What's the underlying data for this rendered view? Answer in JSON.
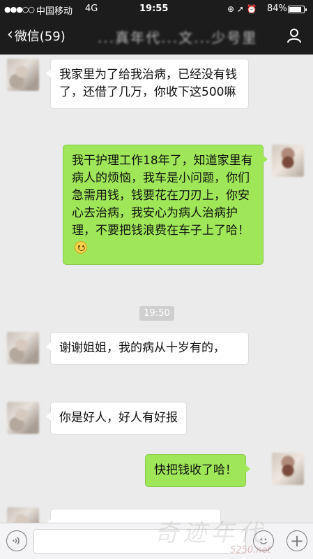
{
  "status_bar": {
    "signal": "●●●○○",
    "carrier": "中国移动",
    "network": "4G",
    "time": "19:55",
    "icons": "⊕ ➚ ⏰",
    "battery_pct": "84%",
    "battery_level": 0.84
  },
  "nav": {
    "back_label": "微信(59)",
    "chat_title": "...真年代...文...少号里",
    "profile_icon": "person-icon"
  },
  "messages": [
    {
      "side": "in",
      "text": "我家里为了给我治病，已经没有钱了，还借了几万，你收下这500嘛"
    },
    {
      "side": "out",
      "text": "我干护理工作18年了，知道家里有病人的烦恼，我车是小问题，你们急需用钱，钱要花在刀刃上，你安心去治病，我安心为病人治病护理，不要把钱浪费在车子上了哈！"
    },
    {
      "side": "in",
      "text": "谢谢姐姐，我的病从十岁有的，"
    },
    {
      "side": "in",
      "text": "你是好人，好人有好报"
    },
    {
      "side": "out",
      "text": "快把钱收了哈！"
    }
  ],
  "time_separator": "19:50",
  "input_bar": {
    "voice_icon": "voice-icon",
    "emoji_icon": "emoji-icon",
    "plus_icon": "plus-icon",
    "plus_glyph": "+"
  },
  "watermark": {
    "text": "奇迹年代",
    "url": "5250.net"
  },
  "colors": {
    "header_bg": "#1c1c1c",
    "chat_bg": "#ebebeb",
    "outgoing_bubble": "#9fe759",
    "incoming_bubble": "#ffffff"
  }
}
